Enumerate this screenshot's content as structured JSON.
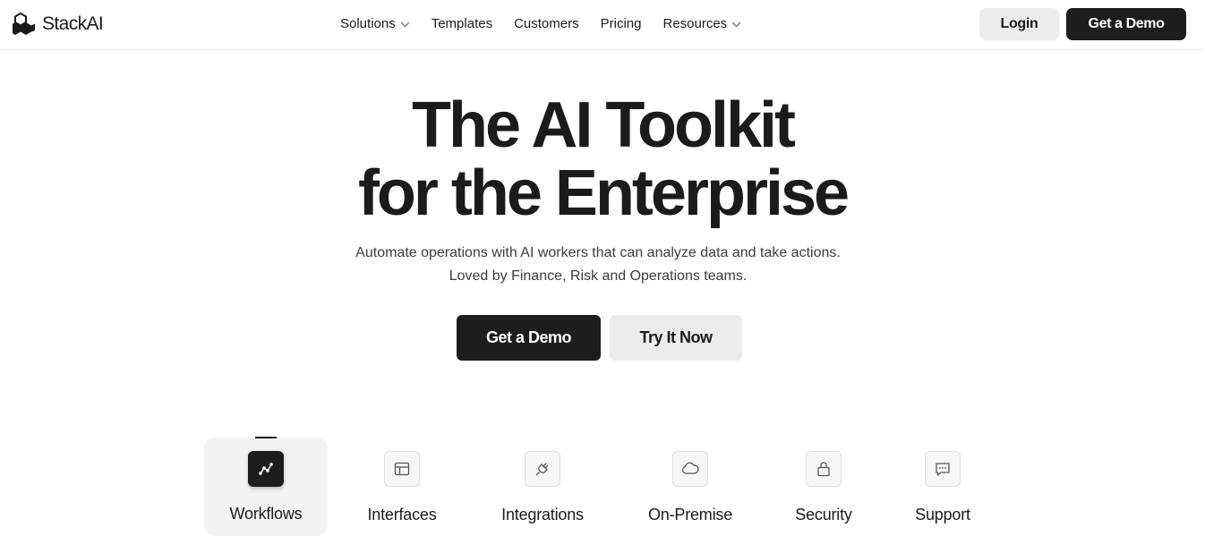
{
  "brand": {
    "name": "StackAI"
  },
  "nav": {
    "items": [
      {
        "label": "Solutions",
        "has_dropdown": true
      },
      {
        "label": "Templates",
        "has_dropdown": false
      },
      {
        "label": "Customers",
        "has_dropdown": false
      },
      {
        "label": "Pricing",
        "has_dropdown": false
      },
      {
        "label": "Resources",
        "has_dropdown": true
      }
    ],
    "login_label": "Login",
    "demo_label": "Get a Demo"
  },
  "hero": {
    "title_line1": "The AI Toolkit",
    "title_line2": "for the Enterprise",
    "subtitle_line1": "Automate operations with AI workers that can analyze data and take actions.",
    "subtitle_line2": "Loved by Finance, Risk and Operations teams.",
    "primary_cta": "Get a Demo",
    "secondary_cta": "Try It Now"
  },
  "features": {
    "active_tab": "Workflows",
    "tabs": [
      {
        "label": "Workflows",
        "icon": "workflow-icon"
      },
      {
        "label": "Interfaces",
        "icon": "layout-icon"
      },
      {
        "label": "Integrations",
        "icon": "plug-icon"
      },
      {
        "label": "On-Premise",
        "icon": "cloud-icon"
      },
      {
        "label": "Security",
        "icon": "lock-icon"
      },
      {
        "label": "Support",
        "icon": "chat-icon"
      }
    ]
  },
  "colors": {
    "primary": "#1d1d1d",
    "secondary_bg": "#ececec",
    "text": "#1b1b1b"
  }
}
